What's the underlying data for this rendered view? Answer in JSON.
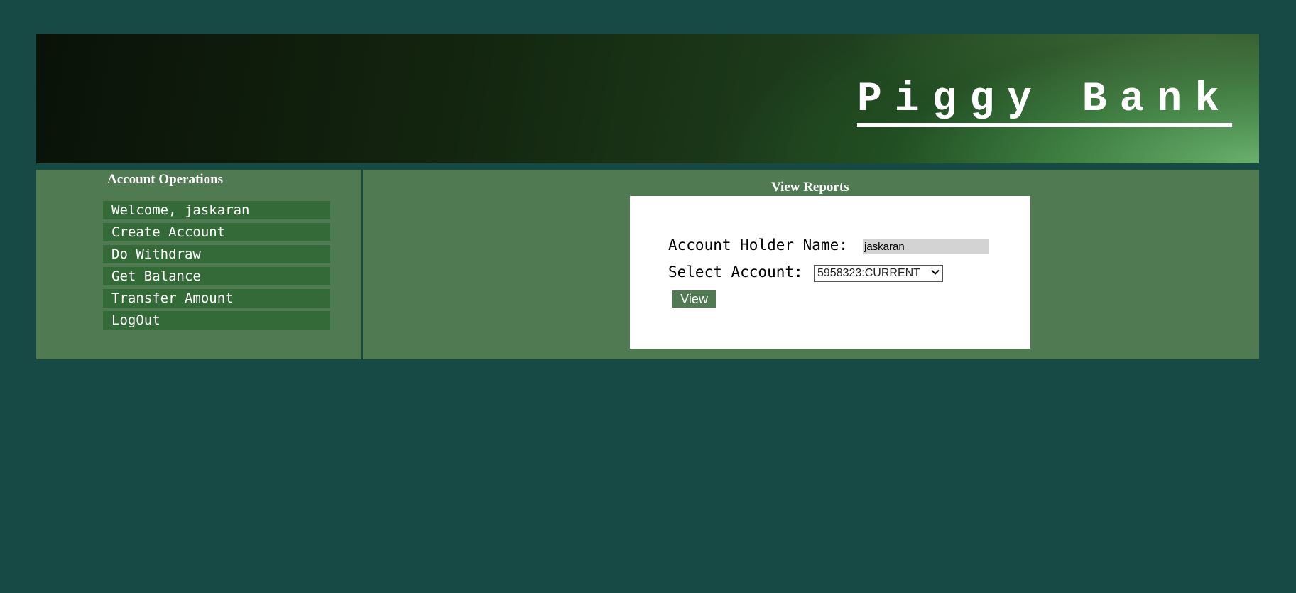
{
  "header": {
    "title": "Piggy Bank"
  },
  "sidebar": {
    "heading": "Account Operations",
    "items": [
      {
        "label": "Welcome, jaskaran"
      },
      {
        "label": "Create Account"
      },
      {
        "label": "Do Withdraw"
      },
      {
        "label": "Get Balance"
      },
      {
        "label": "Transfer Amount"
      },
      {
        "label": "LogOut"
      }
    ]
  },
  "main": {
    "heading": "View Reports",
    "form": {
      "name_label": "Account Holder Name:",
      "name_value": "jaskaran",
      "account_label": "Select Account:",
      "account_selected": "5958323:CURRENT",
      "view_label": "View"
    }
  },
  "colors": {
    "page_background": "#184a45",
    "panel_background": "#4f7a52",
    "menu_item_background": "#346938",
    "header_accent": "#6ab06e"
  },
  "icons": {
    "select_arrow": "chevron-down-icon"
  }
}
